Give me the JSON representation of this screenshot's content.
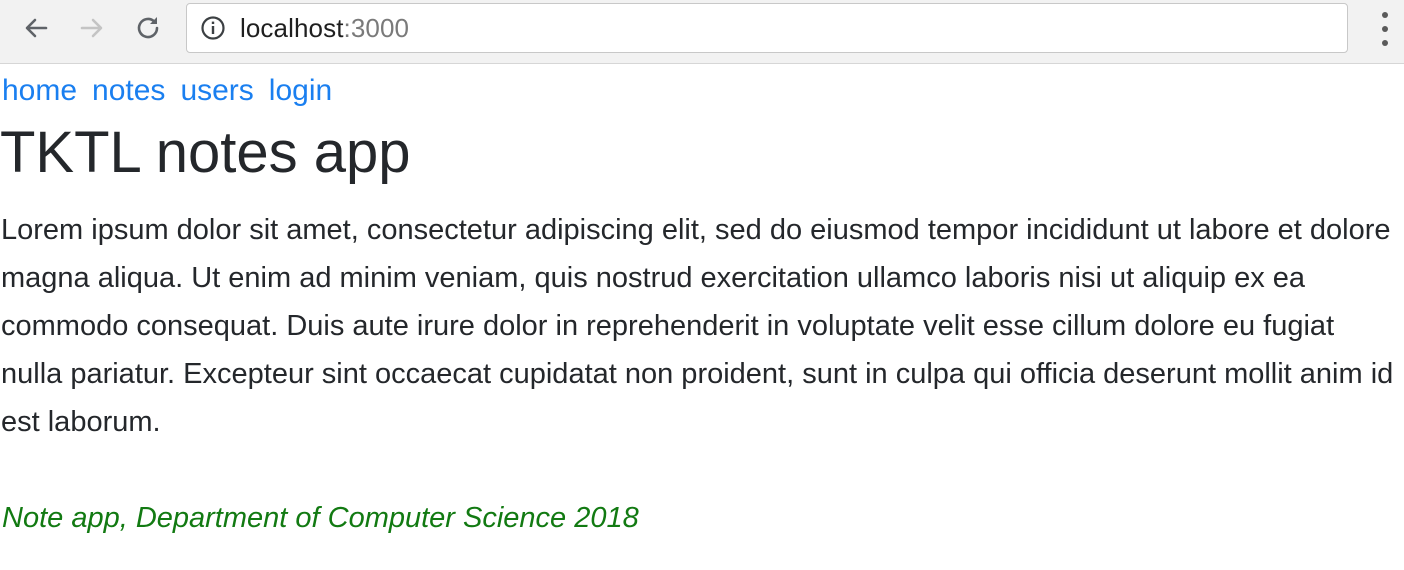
{
  "browser": {
    "url_host": "localhost",
    "url_port": ":3000",
    "icons": {
      "back": "arrow-left-icon",
      "forward": "arrow-right-icon",
      "reload": "reload-icon",
      "info": "info-icon",
      "menu": "kebab-menu-icon"
    }
  },
  "nav": {
    "links": [
      {
        "label": "home"
      },
      {
        "label": "notes"
      },
      {
        "label": "users"
      },
      {
        "label": "login"
      }
    ],
    "link_color": "#1a7ff0"
  },
  "main": {
    "title": "TKTL notes app",
    "body": "Lorem ipsum dolor sit amet, consectetur adipiscing elit, sed do eiusmod tempor incididunt ut labore et dolore magna aliqua. Ut enim ad minim veniam, quis nostrud exercitation ullamco laboris nisi ut aliquip ex ea commodo consequat. Duis aute irure dolor in reprehenderit in voluptate velit esse cillum dolore eu fugiat nulla pariatur. Excepteur sint occaecat cupidatat non proident, sunt in culpa qui officia deserunt mollit anim id est laborum."
  },
  "footer": {
    "text": "Note app, Department of Computer Science 2018",
    "color": "#127a12"
  }
}
